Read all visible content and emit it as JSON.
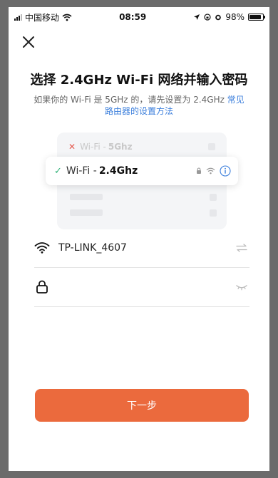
{
  "status_bar": {
    "carrier": "中国移动",
    "time": "08:59",
    "battery_percent": "98%",
    "battery_level": 0.98
  },
  "close_icon": "close-icon",
  "title": "选择 2.4GHz Wi-Fi 网络并输入密码",
  "subtitle": {
    "text": "如果你的 Wi-Fi 是 5GHz 的，请先设置为 2.4GHz",
    "link": "常见路由器的设置方法"
  },
  "illustration": {
    "wifi_5g": {
      "prefix": "Wi-Fi -",
      "band": "5Ghz"
    },
    "wifi_24g": {
      "prefix": "Wi-Fi -",
      "band": "2.4Ghz"
    }
  },
  "form": {
    "ssid_value": "TP-LINK_4607",
    "password_value": ""
  },
  "next_button": "下一步",
  "colors": {
    "accent": "#eb6a3d",
    "link": "#3c7fdc",
    "check": "#33b37a",
    "error": "#e55b4f"
  }
}
